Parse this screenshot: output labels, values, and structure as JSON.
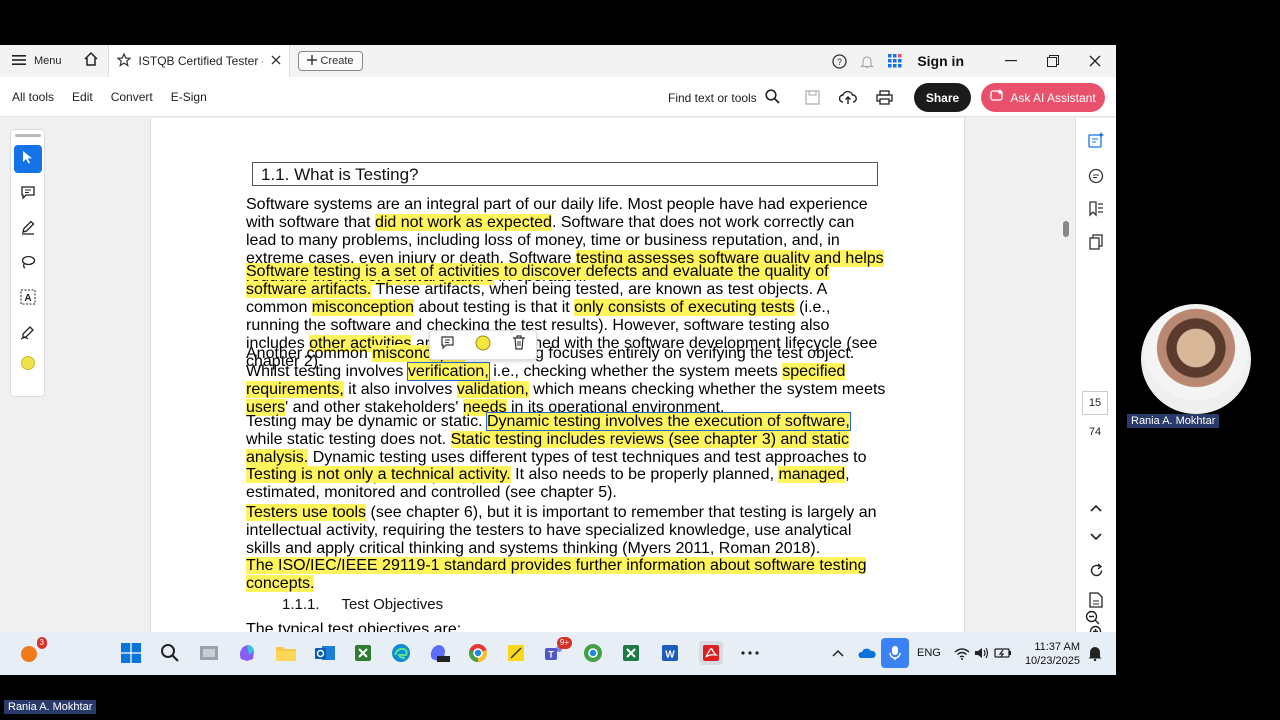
{
  "titlebar": {
    "menu_label": "Menu",
    "tab_title": "ISTQB Certified Tester - ...",
    "create_label": "Create",
    "signin_label": "Sign in"
  },
  "toolbar": {
    "all_tools": "All tools",
    "edit": "Edit",
    "convert": "Convert",
    "esign": "E-Sign",
    "find": "Find text or tools",
    "share": "Share",
    "ai_assistant": "Ask AI Assistant"
  },
  "doc": {
    "heading": "1.1. What is Testing?",
    "p1": [
      {
        "t": "Software systems are an integral part of our daily life. Most people have had experience with software that "
      },
      {
        "t": "did not work as expected",
        "h": true
      },
      {
        "t": ". Software that does not work correctly can lead to many problems, including loss of money, time or business reputation, and, in extreme cases, even injury or death. Software "
      },
      {
        "t": "testing assesses software quality and helps reducing the risk of software failure",
        "h": true
      },
      {
        "t": " in operation."
      }
    ],
    "p2": [
      {
        "t": "Software testing is a set of activities to discover defects and evaluate the quality of software artifacts.",
        "h": true
      },
      {
        "t": " These artifacts, when being tested, are known as test objects. A common "
      },
      {
        "t": "misconception",
        "h": true
      },
      {
        "t": " about testing is that it "
      },
      {
        "t": "only consists of executing tests",
        "h": true
      },
      {
        "t": " (i.e., running the software and checking the test results). However, software testing also includes "
      },
      {
        "t": "other activities",
        "h": true
      },
      {
        "t": " and must be aligned with the software development lifecycle (see chapter 2)."
      }
    ],
    "p3": [
      {
        "t": "Another common "
      },
      {
        "t": "misconceptio",
        "h": true
      },
      {
        "t": "                            hat testing focuses entirely on verifying the test object. Whilst testing involves "
      },
      {
        "t": "verification,",
        "h": true,
        "s": true
      },
      {
        "t": " i.e., checking whether the system meets "
      },
      {
        "t": "specified requirements,",
        "h": true
      },
      {
        "t": " it also involves "
      },
      {
        "t": "validation,",
        "h": true
      },
      {
        "t": " which means checking whether the system meets "
      },
      {
        "t": "users",
        "h": true
      },
      {
        "t": "' and other stakeholders' "
      },
      {
        "t": "needs",
        "h": true
      },
      {
        "t": " in its operational environment."
      }
    ],
    "p4": [
      {
        "t": "Testing may be dynamic or static. "
      },
      {
        "t": "Dynamic testing involves the execution of software,",
        "h": true,
        "s": true
      },
      {
        "t": " while static testing does not. "
      },
      {
        "t": "Static testing includes reviews (see chapter 3) and static analysis.",
        "h": true
      },
      {
        "t": " Dynamic testing uses different types of test techniques and test approaches to derive test cases (see chapter 4)."
      }
    ],
    "p5": [
      {
        "t": "Testing is not only a technical activity.",
        "h": true
      },
      {
        "t": " It also needs to be properly planned, "
      },
      {
        "t": "managed",
        "h": true
      },
      {
        "t": ", estimated, monitored and controlled (see chapter 5)."
      }
    ],
    "p6": [
      {
        "t": "Testers use tools",
        "h": true
      },
      {
        "t": " (see chapter 6), but it is important to remember that testing is largely an intellectual activity, requiring the testers to have specialized knowledge, use analytical skills and apply critical thinking and systems thinking (Myers 2011, Roman 2018)."
      }
    ],
    "p7": [
      {
        "t": "The ISO/IEC/IEEE 29119-1 standard provides further information about software testing concepts.",
        "h": true
      }
    ],
    "subheading_num": "1.1.1.",
    "subheading_text": "Test Objectives",
    "p8": "The typical test objectives are:"
  },
  "rail": {
    "page_current": "15",
    "page_total": "74"
  },
  "taskbar": {
    "notif_badge": "3",
    "teams_badge": "9+",
    "lang": "ENG",
    "time": "11:37 AM",
    "date": "10/23/2025"
  },
  "cam_label": "Rania A. Mokhtar",
  "bottom_label": "Rania A. Mokhtar",
  "colors": {
    "highlight": "#fff45c",
    "accent_blue": "#1473e6",
    "ai_button": "#e8506b"
  }
}
